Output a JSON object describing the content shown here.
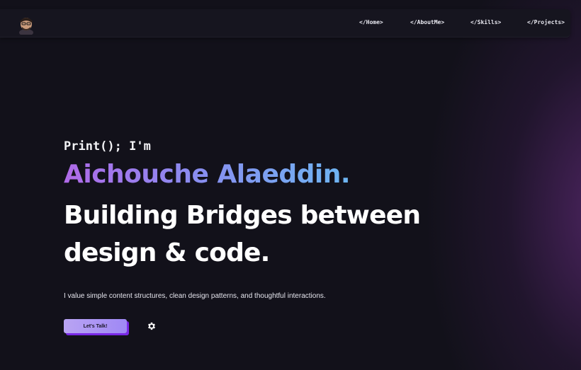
{
  "nav": {
    "avatar_icon": "avatar-memoji",
    "links": [
      {
        "label": "</Home>"
      },
      {
        "label": "</AboutMe>"
      },
      {
        "label": "</Skills>"
      },
      {
        "label": "</Projects>"
      }
    ]
  },
  "hero": {
    "intro": "Print(); I'm",
    "name": "Aichouche Alaeddin.",
    "tagline": "Building Bridges between design & code.",
    "description": "I value simple content structures, clean design patterns, and thoughtful interactions.",
    "cta_label": "Let's Talk!",
    "settings_icon": "gear-icon"
  },
  "colors": {
    "background": "#12111a",
    "navbar": "#16151f",
    "name_gradient_start": "#b06ae8",
    "name_gradient_end": "#6db6f2",
    "cta_shadow": "#7a28e6",
    "glow": "#58286e"
  }
}
